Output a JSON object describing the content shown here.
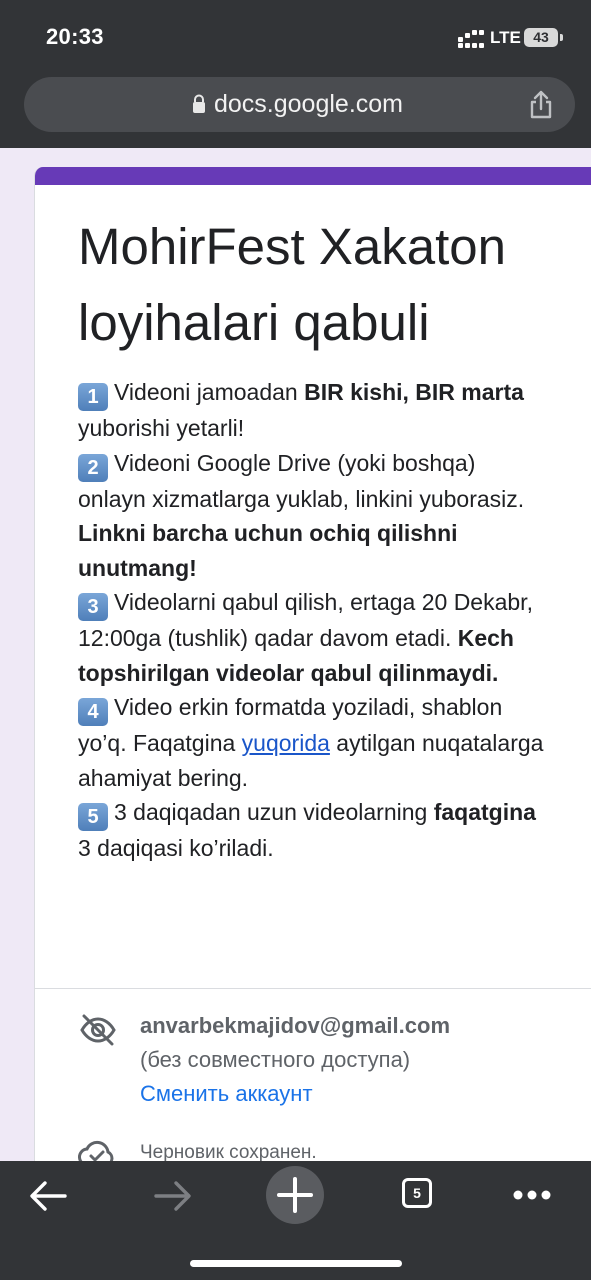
{
  "status_bar": {
    "time": "20:33",
    "network": "LTE",
    "battery": "43"
  },
  "browser": {
    "url": "docs.google.com",
    "tab_count": "5"
  },
  "form": {
    "title_line1": "MohirFest Xakaton",
    "title_line2": "loyihalari qabuli",
    "keycaps": [
      "1",
      "2",
      "3",
      "4",
      "5"
    ],
    "items": {
      "i1a": "Videoni jamoadan ",
      "i1b": "BIR kishi, BIR marta",
      "i1c": "yuborishi yetarli!",
      "i2a": "Videoni Google Drive (yoki boshqa)",
      "i2b": "onlayn xizmatlarga yuklab, linkini yuborasiz.",
      "i2c": "Linkni barcha uchun ochiq qilishni",
      "i2d": "unutmang!",
      "i3a": "Videolarni qabul qilish, ertaga 20 Dekabr,",
      "i3b": "12:00ga (tushlik) qadar davom etadi. ",
      "i3c": "Kech",
      "i3d": "topshirilgan videolar qabul qilinmaydi.",
      "i4a": "Video erkin formatda yoziladi, shablon",
      "i4b": "yo’q. Faqatgina ",
      "i4link": "yuqorida",
      "i4c": " aytilgan nuqatalarga",
      "i4d": "ahamiyat bering.",
      "i5a": "3 daqiqadan uzun videolarning ",
      "i5b": "faqatgina",
      "i5c": "3 daqiqasi ko’riladi."
    }
  },
  "account": {
    "email": "anvarbekmajidov@gmail.com",
    "note": "(без совместного доступа)",
    "switch_label": "Сменить аккаунт",
    "draft_status": "Черновик сохранен."
  },
  "colors": {
    "accent": "#673ab7",
    "link": "#1a73e8",
    "chrome": "#323437"
  }
}
